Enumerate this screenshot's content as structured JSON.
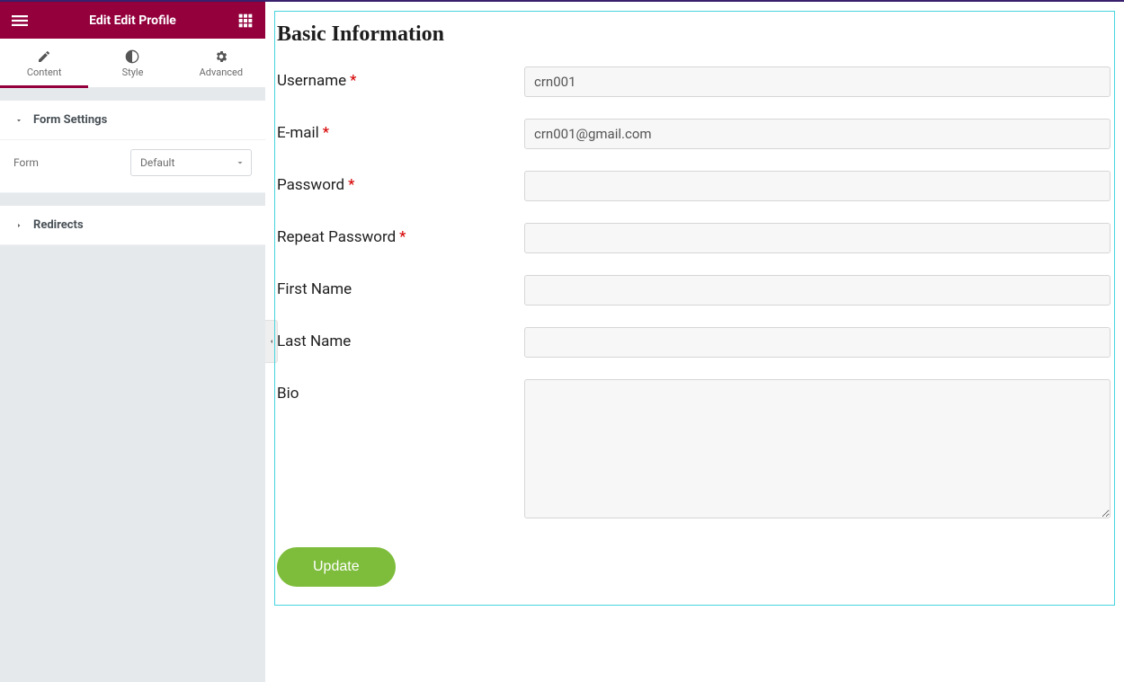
{
  "sidebar": {
    "title": "Edit Edit Profile",
    "tabs": [
      {
        "key": "content",
        "label": "Content",
        "icon": "pencil-icon",
        "active": true
      },
      {
        "key": "style",
        "label": "Style",
        "icon": "half-circle-icon",
        "active": false
      },
      {
        "key": "advanced",
        "label": "Advanced",
        "icon": "gear-icon",
        "active": false
      }
    ],
    "sections": {
      "form_settings": {
        "title": "Form Settings",
        "expanded": true,
        "controls": {
          "form": {
            "label": "Form",
            "value": "Default"
          }
        }
      },
      "redirects": {
        "title": "Redirects",
        "expanded": false
      }
    }
  },
  "form": {
    "heading": "Basic Information",
    "fields": {
      "username": {
        "label": "Username",
        "required": true,
        "value": "crn001"
      },
      "email": {
        "label": "E-mail",
        "required": true,
        "value": "crn001@gmail.com"
      },
      "password": {
        "label": "Password",
        "required": true,
        "value": ""
      },
      "repeat_password": {
        "label": "Repeat Password",
        "required": true,
        "value": ""
      },
      "first_name": {
        "label": "First Name",
        "required": false,
        "value": ""
      },
      "last_name": {
        "label": "Last Name",
        "required": false,
        "value": ""
      },
      "bio": {
        "label": "Bio",
        "required": false,
        "value": ""
      }
    },
    "submit_label": "Update"
  }
}
